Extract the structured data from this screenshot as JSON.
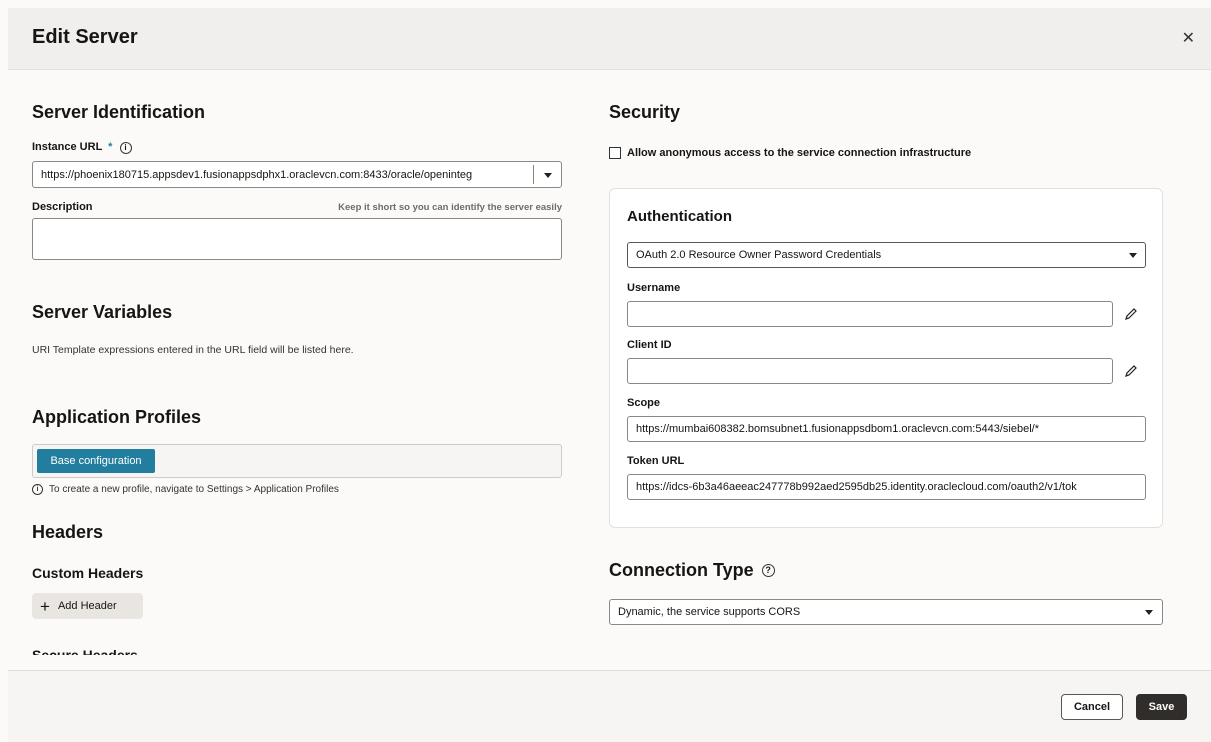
{
  "dialog": {
    "title": "Edit Server",
    "close_icon": "close-icon"
  },
  "server_identification": {
    "heading": "Server Identification",
    "instance_url_label": "Instance URL",
    "required_mark": "*",
    "instance_url_value": "https://phoenix180715.appsdev1.fusionappsdphx1.oraclevcn.com:8433/oracle/openinteg",
    "description_label": "Description",
    "description_hint": "Keep it short so you can identify the server easily",
    "description_value": ""
  },
  "server_variables": {
    "heading": "Server Variables",
    "text": "URI Template expressions entered in the URL field will be listed here."
  },
  "application_profiles": {
    "heading": "Application Profiles",
    "chip": "Base configuration",
    "info": "To create a new profile, navigate to Settings > Application Profiles"
  },
  "headers": {
    "heading": "Headers",
    "custom_heading": "Custom Headers",
    "add_button": "Add Header",
    "secure_heading": "Secure Headers"
  },
  "security": {
    "heading": "Security",
    "anonymous_label": "Allow anonymous access to the service connection infrastructure",
    "anonymous_checked": false
  },
  "authentication": {
    "heading": "Authentication",
    "type": "OAuth 2.0 Resource Owner Password Credentials",
    "username_label": "Username",
    "username_value": "",
    "client_id_label": "Client ID",
    "client_id_value": "",
    "scope_label": "Scope",
    "scope_value": "https://mumbai608382.bomsubnet1.fusionappsdbom1.oraclevcn.com:5443/siebel/*",
    "token_url_label": "Token URL",
    "token_url_value": "https://idcs-6b3a46aeeac247778b992aed2595db25.identity.oraclecloud.com/oauth2/v1/tok"
  },
  "connection_type": {
    "heading": "Connection Type",
    "value": "Dynamic, the service supports CORS"
  },
  "footer": {
    "cancel_label": "Cancel",
    "save_label": "Save"
  },
  "colors": {
    "primary_button": "#312d2a",
    "chip": "#227e9e",
    "required": "#227e9e"
  }
}
